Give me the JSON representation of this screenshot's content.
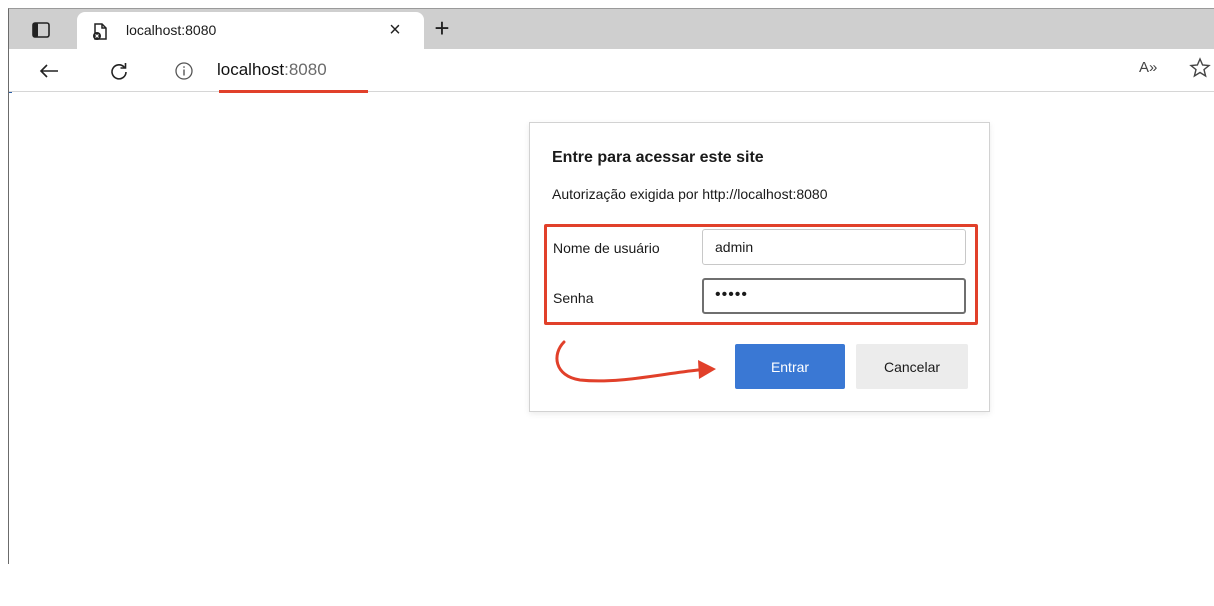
{
  "browser": {
    "tab": {
      "title": "localhost:8080",
      "close_glyph": "×"
    },
    "new_tab_glyph": "+",
    "address": {
      "host": "localhost",
      "port": ":8080"
    },
    "icons": {
      "tab_actions": "tab-actions-icon",
      "favicon": "page-error-icon",
      "back": "back-arrow-icon",
      "reload": "reload-icon",
      "info": "info-icon",
      "read_aloud": "read-aloud-icon",
      "favorites": "star-icon"
    },
    "read_aloud_label": "A»"
  },
  "dialog": {
    "title": "Entre para acessar este site",
    "subtitle": "Autorização exigida por http://localhost:8080",
    "username_label": "Nome de usuário",
    "username_value": "admin",
    "password_label": "Senha",
    "password_value": "•••••",
    "submit_label": "Entrar",
    "cancel_label": "Cancelar"
  },
  "annotation": {
    "highlight_color": "#e1402a"
  },
  "colors": {
    "accent": "#3a78d4",
    "annotation": "#e1402a"
  }
}
